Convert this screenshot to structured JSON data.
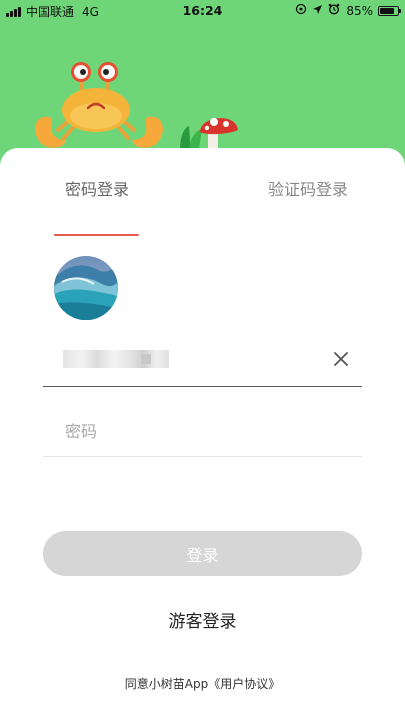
{
  "status_bar": {
    "carrier": "中国联通",
    "network": "4G",
    "time": "16:24",
    "battery_percent": "85%",
    "battery_level": 0.85,
    "icons": [
      "signal-icon",
      "orientation-lock-icon",
      "location-icon",
      "alarm-icon",
      "battery-icon"
    ]
  },
  "header": {
    "illustration": [
      "crab-icon",
      "grass-icon",
      "mushroom-icon"
    ],
    "background_color": "#6ed678"
  },
  "tabs": [
    {
      "label": "密码登录",
      "active": true
    },
    {
      "label": "验证码登录",
      "active": false
    }
  ],
  "form": {
    "password_placeholder": "密码",
    "clear_icon": "close-icon"
  },
  "buttons": {
    "login": "登录",
    "guest_login": "游客登录"
  },
  "agreement": {
    "prefix": "同意小树苗App",
    "link": "《用户协议》"
  },
  "colors": {
    "accent": "#e65b4f",
    "disabled_button": "#d6d6d6"
  }
}
